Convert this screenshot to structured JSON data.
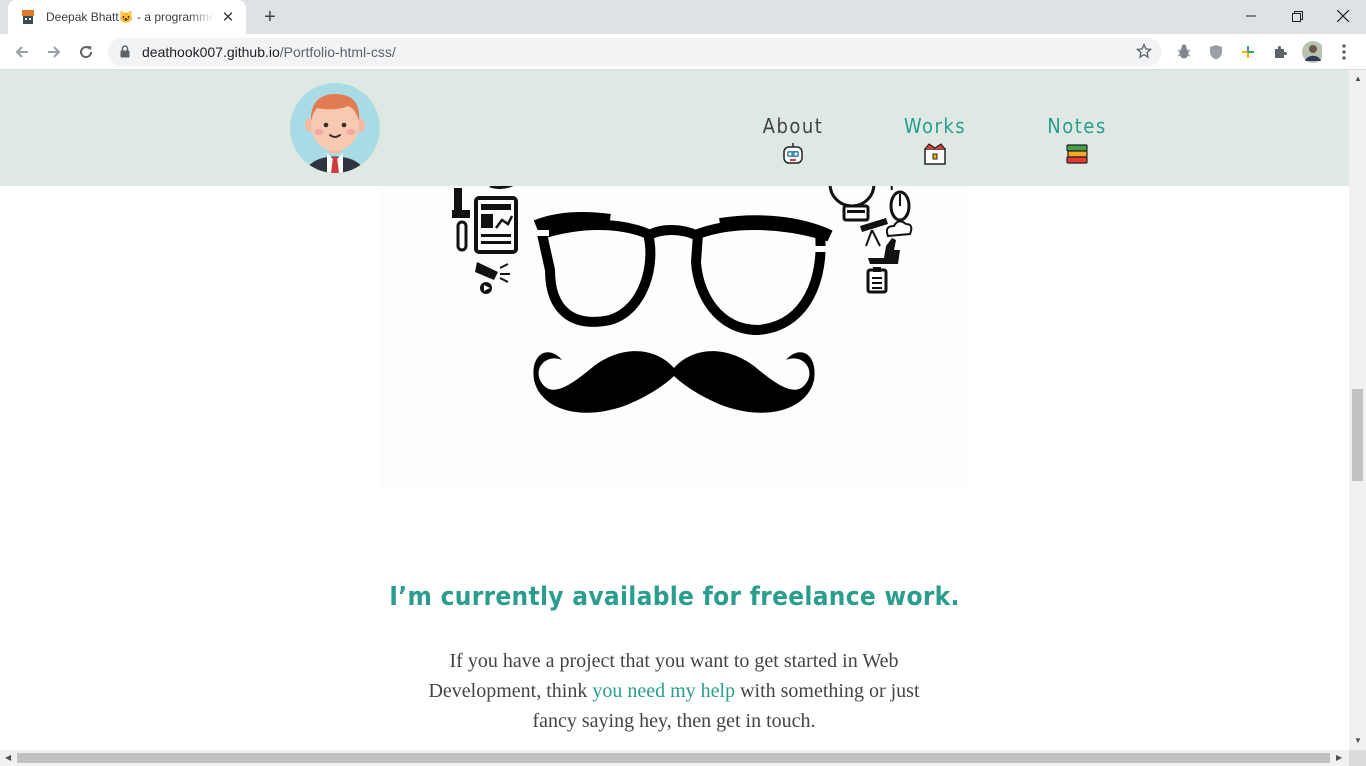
{
  "browser": {
    "tab_title": "Deepak Bhatt😺 - a programmer",
    "tab_close": "✕",
    "new_tab": "+",
    "url_host": "deathook007.github.io",
    "url_path": "/Portfolio-html-css/"
  },
  "site": {
    "nav": [
      {
        "label": "About",
        "color": "#444444"
      },
      {
        "label": "Works",
        "color": "#2a9d8f"
      },
      {
        "label": "Notes",
        "color": "#2a9d8f"
      }
    ]
  },
  "freelance": {
    "title": "I’m currently available for freelance work.",
    "text_before": "If you have a project that you want to get started in Web Development, think ",
    "link": "you need my help",
    "text_after": " with something or just fancy saying hey, then get in touch."
  },
  "colors": {
    "header_bg": "#dfe9e4",
    "accent": "#2a9d8f"
  }
}
